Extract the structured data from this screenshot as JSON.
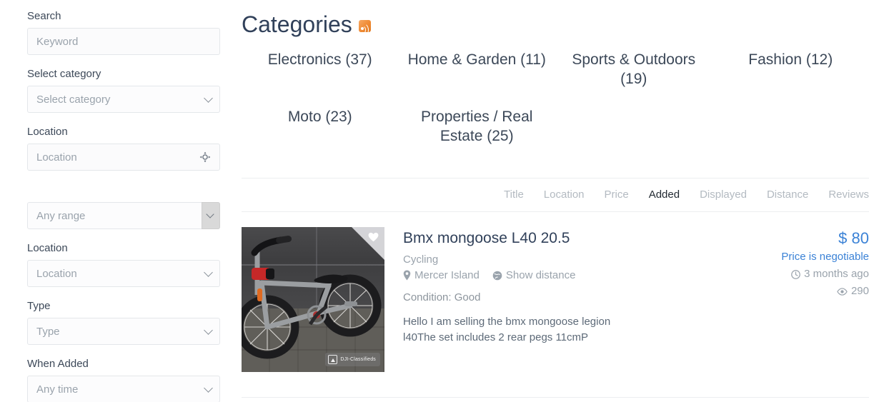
{
  "sidebar": {
    "fields": [
      {
        "label": "Search",
        "value": "Keyword",
        "kind": "input-text",
        "name": "search"
      },
      {
        "label": "Select category",
        "value": "Select category",
        "kind": "select",
        "name": "category"
      },
      {
        "label": "Location",
        "value": "Location",
        "kind": "input-geo",
        "name": "location-text"
      },
      {
        "label": "",
        "value": "Any range",
        "kind": "select-split",
        "name": "range"
      },
      {
        "label": "Location",
        "value": "Location",
        "kind": "select",
        "name": "location-select"
      },
      {
        "label": "Type",
        "value": "Type",
        "kind": "select",
        "name": "type"
      },
      {
        "label": "When Added",
        "value": "Any time",
        "kind": "select",
        "name": "when-added"
      }
    ],
    "icons": {
      "geolocate": "crosshairs-icon",
      "chevron": "chevron-down-icon"
    }
  },
  "main": {
    "title": "Categories",
    "rss_icon": "rss-icon",
    "categories": [
      {
        "label": "Electronics (37)"
      },
      {
        "label": "Home & Garden (11)"
      },
      {
        "label": "Sports & Outdoors (19)"
      },
      {
        "label": "Fashion (12)"
      },
      {
        "label": "Moto (23)"
      },
      {
        "label": "Properties / Real Estate (25)"
      }
    ],
    "sort": {
      "options": [
        "Title",
        "Location",
        "Price",
        "Added",
        "Displayed",
        "Distance",
        "Reviews"
      ],
      "active": "Added"
    },
    "listings": [
      {
        "title": "Bmx mongoose L40 20.5",
        "category": "Cycling",
        "location": "Mercer Island",
        "distance_link": "Show distance",
        "condition": "Condition: Good",
        "description": "Hello I am selling the bmx mongoose legion l40The set includes 2 rear pegs 11cmP",
        "price": "$ 80",
        "negotiable": "Price is negotiable",
        "added": "3 months ago",
        "views": "290",
        "watermark": "DJI-Classifieds",
        "icons": {
          "favorite": "heart-icon",
          "location": "map-pin-icon",
          "distance": "globe-icon",
          "time": "clock-icon",
          "views": "eye-icon"
        }
      }
    ]
  },
  "colors": {
    "accent_blue": "#3b82d6",
    "rss_orange": "#ef8a33",
    "text_dark": "#31415a",
    "text_muted": "#9aa3ac",
    "border": "#e4e7ea"
  }
}
